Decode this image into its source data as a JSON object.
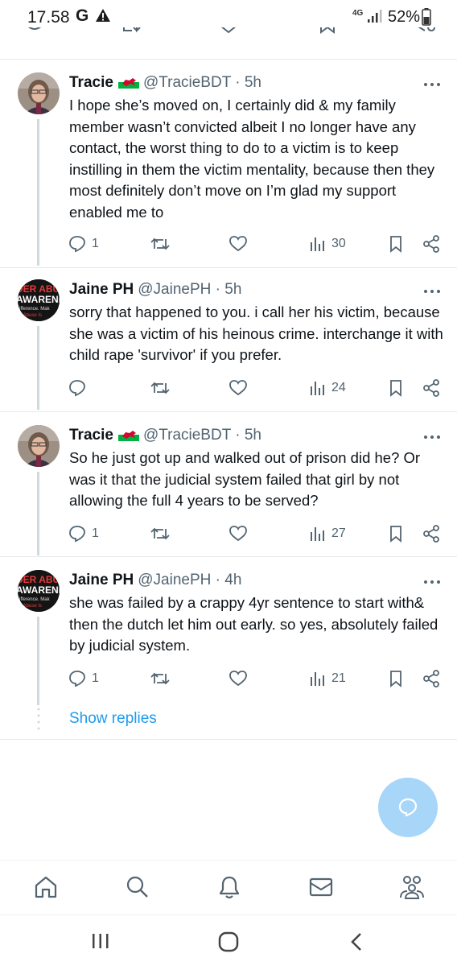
{
  "status_bar": {
    "time": "17.58",
    "g_label": "G",
    "network": "4G",
    "battery": "52%"
  },
  "tweets": [
    {
      "name": "Tracie",
      "handle": "@TracieBDT · 5h",
      "flag": "wales-flag-icon",
      "text": "I hope she’s moved on, I certainly did & my family member wasn’t convicted albeit I no longer have any contact, the worst thing to do to a victim is to keep instilling in them the victim mentality, because then they most definitely don’t move on I’m glad my support enabled me to",
      "replies": "1",
      "views": "30"
    },
    {
      "name": "Jaine PH",
      "handle": "@JainePH · 5h",
      "text": "sorry that happened to you. i call her his victim, because she was a victim of his heinous crime. interchange it with child rape 'survivor' if you prefer.",
      "replies": "",
      "views": "24"
    },
    {
      "name": "Tracie",
      "handle": "@TracieBDT · 5h",
      "flag": "wales-flag-icon",
      "text": "So he just got up and walked out of prison did he? Or was it that the judicial system failed that girl by not allowing the full 4 years to be served?",
      "replies": "1",
      "views": "27"
    },
    {
      "name": "Jaine PH",
      "handle": "@JainePH · 4h",
      "text": "she was failed by a crappy 4yr sentence to start with& then the dutch let him out early. so yes, absolutely failed by judicial system.",
      "replies": "1",
      "views": "21"
    }
  ],
  "show_replies": "Show replies",
  "avatar_jaine": {
    "line1": "DER ABU",
    "line2": "AWARENES",
    "line3": "ifference. Mak",
    "line4": "i Abuse Is"
  },
  "colors": {
    "accent": "#1d9bf0",
    "fab": "#a8d6f9",
    "muted": "#536471"
  }
}
